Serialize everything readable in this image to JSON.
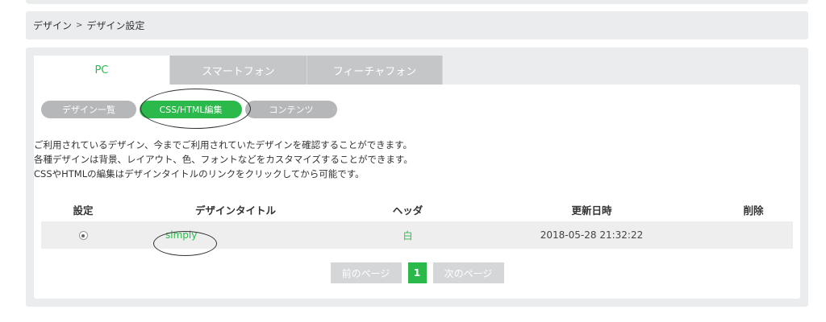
{
  "breadcrumb": {
    "items": [
      "デザイン",
      "デザイン設定"
    ],
    "separator": ">"
  },
  "tabs": [
    {
      "label": "PC",
      "active": true
    },
    {
      "label": "スマートフォン",
      "active": false
    },
    {
      "label": "フィーチャフォン",
      "active": false
    }
  ],
  "subtabs": [
    {
      "label": "デザイン一覧",
      "active": false
    },
    {
      "label": "CSS/HTML編集",
      "active": true
    },
    {
      "label": "コンテンツ",
      "active": false
    }
  ],
  "description": [
    "ご利用されているデザイン、今までご利用されていたデザインを確認することができます。",
    "各種デザインは背景、レイアウト、色、フォントなどをカスタマイズすることができます。",
    "CSSやHTMLの編集はデザインタイトルのリンクをクリックしてから可能です。"
  ],
  "table": {
    "headers": {
      "setting": "設定",
      "title": "デザインタイトル",
      "header": "ヘッダ",
      "updated": "更新日時",
      "delete": "削除"
    },
    "rows": [
      {
        "selected": true,
        "title": "simply",
        "header": "白",
        "updated": "2018-05-28 21:32:22",
        "delete": ""
      }
    ]
  },
  "pagination": {
    "prev_label": "前のページ",
    "current": "1",
    "next_label": "次のページ"
  },
  "colors": {
    "accent": "#2cb94c",
    "panel": "#ebeced",
    "inactive_tab": "#c4c6c8"
  }
}
